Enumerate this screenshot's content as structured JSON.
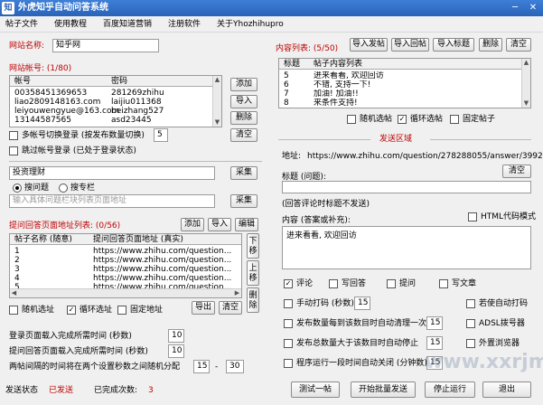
{
  "window": {
    "icon_glyph": "知",
    "title": "外虎知乎自动问答系统",
    "minimize_glyph": "─",
    "close_glyph": "✕"
  },
  "menu": [
    "帖子文件",
    "使用教程",
    "百度知道营销",
    "注册软件",
    "关于Yhozhihupro"
  ],
  "site": {
    "label": "网站名称:",
    "value": "知乎网"
  },
  "accounts": {
    "label": "网站帐号:",
    "count": "(1/80)",
    "col_account": "帐号",
    "col_password": "密码",
    "rows": [
      [
        "00358451369653",
        "281269zhihu"
      ],
      [
        "liao2809148163.com",
        "laijiu011368"
      ],
      [
        "leiyouwengyue@163.com",
        "beizhang527"
      ],
      [
        "13144587565",
        "asd23445"
      ]
    ],
    "buttons": [
      "添加",
      "导入",
      "删除",
      "清空"
    ]
  },
  "options_left": {
    "multi_login": "多帐号切换登录 (按发布数量切换)",
    "multi_login_value": "5",
    "skip_login": "跳过帐号登录 (已处于登录状态)"
  },
  "collect": {
    "keyword_value": "投资理财",
    "collect_button": "采集",
    "radio_search": "搜问题",
    "radio_column": "搜专栏",
    "url_placeholder": "输入具体问题栏块列表页面地址",
    "collect_button2": "采集"
  },
  "answer_urls": {
    "label": "提问回答页面地址列表:",
    "count": "(0/56)",
    "buttons": [
      "添加",
      "导入",
      "编辑"
    ],
    "col_name": "帖子名称 (随意)",
    "col_url": "提问回答页面地址 (真实)",
    "rows": [
      [
        "1",
        "https://www.zhihu.com/question..."
      ],
      [
        "2",
        "https://www.zhihu.com/question..."
      ],
      [
        "3",
        "https://www.zhihu.com/question..."
      ],
      [
        "4",
        "https://www.zhihu.com/question..."
      ],
      [
        "5",
        "https://www.zhihu.com/question..."
      ]
    ],
    "side_buttons": [
      "下移",
      "上移",
      "删除"
    ],
    "random": "随机选址",
    "loop": "循环选址",
    "fixed": "固定地址",
    "export": "导出",
    "clear": "清空"
  },
  "timings": {
    "login_wait_label": "登录页面载入完成所需时间 (秒数)",
    "login_wait": "10",
    "submit_wait_label": "提问回答页面载入完成所需时间 (秒数)",
    "submit_wait": "10",
    "interval_label": "两帖间隔的时间将在两个设置秒数之间随机分配",
    "interval_min": "15",
    "interval_dash": "-",
    "interval_max": "30"
  },
  "status": {
    "state_label": "发送状态",
    "state_value": "已发送",
    "done_label": "已完成次数:",
    "done_value": "3"
  },
  "content_list": {
    "label": "内容列表:",
    "count": "(5/50)",
    "buttons": [
      "导入发帖",
      "导入回帖",
      "导入标题",
      "删除",
      "清空"
    ],
    "col_title": "标题",
    "col_content": "帖子内容列表",
    "rows": [
      [
        "5",
        "进来看看, 欢迎回访"
      ],
      [
        "6",
        "不错, 支持一下!"
      ],
      [
        "7",
        "加油! 加油!!"
      ],
      [
        "8",
        "来条件支持!"
      ]
    ],
    "random": "随机选帖",
    "loop": "循环选帖",
    "fixed": "固定帖子"
  },
  "send_area": {
    "heading": "发送区域",
    "address_label": "地址:",
    "address_value": "https://www.zhihu.com/question/278288055/answer/3992",
    "title_label": "标题 (问题):",
    "clear_button": "清空",
    "title_note": "(回答评论时标题不发送)",
    "content_label": "内容 (答案或补充):",
    "html_mode": "HTML代码模式",
    "content_value": "进来看看, 欢迎回访",
    "comment": "评论",
    "write_answer": "写回答",
    "ask": "提问",
    "write_article": "写文章"
  },
  "automation": {
    "manual_code": "手动打码 (秒数)",
    "manual_code_value": "15",
    "auto_code": "若使自动打码",
    "clean_after": "发布数量每到该数目时自动清理一次",
    "clean_after_value": "15",
    "adsl": "ADSL拨号器",
    "stop_after": "发布总数量大于该数目时自动停止",
    "stop_after_value": "15",
    "external_browser": "外置浏览器",
    "run_timed": "程序运行一段时间自动关闭 (分钟数)",
    "run_timed_value": "15"
  },
  "bottom_buttons": [
    "测试一帖",
    "开始批量发送",
    "停止运行",
    "退出"
  ],
  "watermark_text": "www.xxrjm.com"
}
